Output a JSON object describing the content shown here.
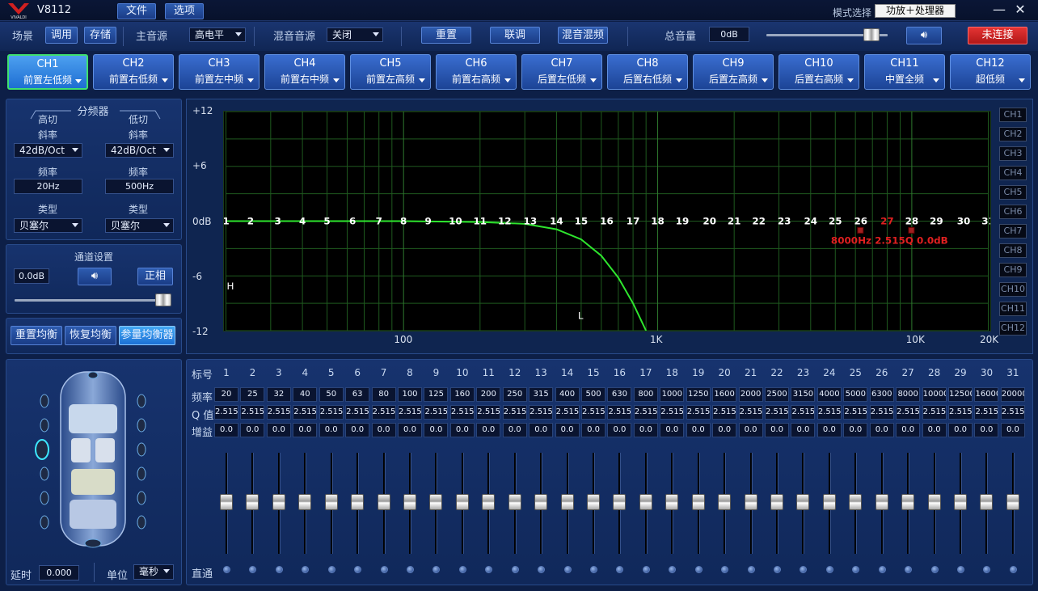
{
  "app": {
    "title": "V8112",
    "brand": "VIVALDI"
  },
  "menu": {
    "file": "文件",
    "options": "选项"
  },
  "mode": {
    "label": "模式选择",
    "value": "功放＋处理器"
  },
  "window": {
    "minimize": "—",
    "close": "✕"
  },
  "toolbar": {
    "scene_label": "场景",
    "recall": "调用",
    "store": "存储",
    "main_source_label": "主音源",
    "main_source_value": "高电平",
    "mix_source_label": "混音音源",
    "mix_source_value": "关闭",
    "reset": "重置",
    "link": "联调",
    "mix_freq": "混音混频",
    "master_volume_label": "总音量",
    "master_volume_value": "0dB",
    "connection_status": "未连接",
    "speaker_icon": "speaker-icon"
  },
  "channels": [
    {
      "id": "CH1",
      "name": "前置左低频"
    },
    {
      "id": "CH2",
      "name": "前置右低频"
    },
    {
      "id": "CH3",
      "name": "前置左中频"
    },
    {
      "id": "CH4",
      "name": "前置右中频"
    },
    {
      "id": "CH5",
      "name": "前置左高频"
    },
    {
      "id": "CH6",
      "name": "前置右高频"
    },
    {
      "id": "CH7",
      "name": "后置左低频"
    },
    {
      "id": "CH8",
      "name": "后置右低频"
    },
    {
      "id": "CH9",
      "name": "后置左高频"
    },
    {
      "id": "CH10",
      "name": "后置右高频"
    },
    {
      "id": "CH11",
      "name": "中置全频"
    },
    {
      "id": "CH12",
      "name": "超低频"
    }
  ],
  "active_channel": 0,
  "crossover": {
    "title": "分频器",
    "high_cut": {
      "label": "高切",
      "slope_label": "斜率",
      "slope": "42dB/Oct",
      "freq_label": "频率",
      "freq": "20Hz",
      "type_label": "类型",
      "type": "贝塞尔"
    },
    "low_cut": {
      "label": "低切",
      "slope_label": "斜率",
      "slope": "42dB/Oct",
      "freq_label": "频率",
      "freq": "500Hz",
      "type_label": "类型",
      "type": "贝塞尔"
    }
  },
  "channel_settings": {
    "title": "通道设置",
    "gain": "0.0dB",
    "phase": "正相",
    "level_percent": 100
  },
  "eq_buttons": {
    "reset": "重置均衡",
    "restore": "恢复均衡",
    "param": "参量均衡器"
  },
  "delay": {
    "label": "延时",
    "value": "0.000",
    "unit_label": "单位",
    "unit": "毫秒"
  },
  "graph": {
    "y_ticks": [
      "+12",
      "+6",
      "0dB",
      "-6",
      "-12"
    ],
    "x_ticks": [
      "100",
      "1K",
      "10K",
      "20K"
    ],
    "h_marker": "H",
    "l_marker": "L",
    "readout": "8000Hz 2.515Q 0.0dB",
    "highlight_band": 27,
    "side_channels": [
      "CH1",
      "CH2",
      "CH3",
      "CH4",
      "CH5",
      "CH6",
      "CH7",
      "CH8",
      "CH9",
      "CH10",
      "CH11",
      "CH12"
    ],
    "colors": {
      "curve": "#2ee62e",
      "readout": "#e02020",
      "grid": "#1f5a1f"
    }
  },
  "chart_data": {
    "type": "line",
    "xlabel": "",
    "ylabel": "",
    "ylim": [
      -12,
      12
    ],
    "xlim": [
      20,
      20000
    ],
    "log_x": true,
    "x": [
      20,
      100,
      200,
      300,
      400,
      500,
      600,
      700,
      800,
      900
    ],
    "y": [
      0.0,
      0.0,
      -0.1,
      -0.3,
      -0.9,
      -2.0,
      -3.8,
      -6.2,
      -9.0,
      -12.0
    ]
  },
  "eq": {
    "row_labels": {
      "band": "标号",
      "freq": "频率",
      "q": "Q 值",
      "gain": "增益",
      "bypass": "直通"
    },
    "bands": [
      {
        "n": "1",
        "f": "20",
        "q": "2.515",
        "g": "0.0"
      },
      {
        "n": "2",
        "f": "25",
        "q": "2.515",
        "g": "0.0"
      },
      {
        "n": "3",
        "f": "32",
        "q": "2.515",
        "g": "0.0"
      },
      {
        "n": "4",
        "f": "40",
        "q": "2.515",
        "g": "0.0"
      },
      {
        "n": "5",
        "f": "50",
        "q": "2.515",
        "g": "0.0"
      },
      {
        "n": "6",
        "f": "63",
        "q": "2.515",
        "g": "0.0"
      },
      {
        "n": "7",
        "f": "80",
        "q": "2.515",
        "g": "0.0"
      },
      {
        "n": "8",
        "f": "100",
        "q": "2.515",
        "g": "0.0"
      },
      {
        "n": "9",
        "f": "125",
        "q": "2.515",
        "g": "0.0"
      },
      {
        "n": "10",
        "f": "160",
        "q": "2.515",
        "g": "0.0"
      },
      {
        "n": "11",
        "f": "200",
        "q": "2.515",
        "g": "0.0"
      },
      {
        "n": "12",
        "f": "250",
        "q": "2.515",
        "g": "0.0"
      },
      {
        "n": "13",
        "f": "315",
        "q": "2.515",
        "g": "0.0"
      },
      {
        "n": "14",
        "f": "400",
        "q": "2.515",
        "g": "0.0"
      },
      {
        "n": "15",
        "f": "500",
        "q": "2.515",
        "g": "0.0"
      },
      {
        "n": "16",
        "f": "630",
        "q": "2.515",
        "g": "0.0"
      },
      {
        "n": "17",
        "f": "800",
        "q": "2.515",
        "g": "0.0"
      },
      {
        "n": "18",
        "f": "1000",
        "q": "2.515",
        "g": "0.0"
      },
      {
        "n": "19",
        "f": "1250",
        "q": "2.515",
        "g": "0.0"
      },
      {
        "n": "20",
        "f": "1600",
        "q": "2.515",
        "g": "0.0"
      },
      {
        "n": "21",
        "f": "2000",
        "q": "2.515",
        "g": "0.0"
      },
      {
        "n": "22",
        "f": "2500",
        "q": "2.515",
        "g": "0.0"
      },
      {
        "n": "23",
        "f": "3150",
        "q": "2.515",
        "g": "0.0"
      },
      {
        "n": "24",
        "f": "4000",
        "q": "2.515",
        "g": "0.0"
      },
      {
        "n": "25",
        "f": "5000",
        "q": "2.515",
        "g": "0.0"
      },
      {
        "n": "26",
        "f": "6300",
        "q": "2.515",
        "g": "0.0"
      },
      {
        "n": "27",
        "f": "8000",
        "q": "2.515",
        "g": "0.0"
      },
      {
        "n": "28",
        "f": "10000",
        "q": "2.515",
        "g": "0.0"
      },
      {
        "n": "29",
        "f": "12500",
        "q": "2.515",
        "g": "0.0"
      },
      {
        "n": "30",
        "f": "16000",
        "q": "2.515",
        "g": "0.0"
      },
      {
        "n": "31",
        "f": "20000",
        "q": "2.515",
        "g": "0.0"
      }
    ]
  }
}
